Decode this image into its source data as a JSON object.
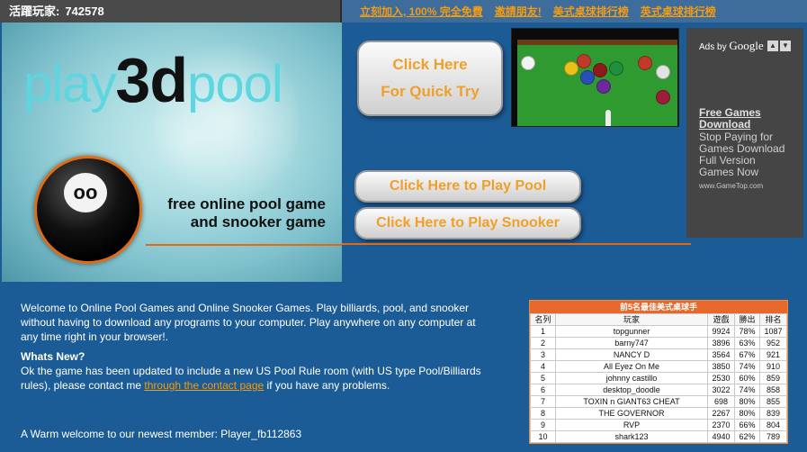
{
  "topbar": {
    "online_label": "活躍玩家:",
    "online_count": "742578",
    "links": [
      "立刻加入, 100% 完全免費",
      "邀請朋友!",
      "美式桌球排行榜",
      "英式桌球排行榜"
    ]
  },
  "hero": {
    "logo_left": "play",
    "logo_mid": "3d",
    "logo_right": "pool",
    "ball_mark": "oo",
    "tagline_1": "free online pool game",
    "tagline_2": "and snooker game"
  },
  "buttons": {
    "quick_1": "Click Here",
    "quick_2": "For Quick Try",
    "play_pool": "Click Here to Play Pool",
    "play_snooker": "Click Here to Play Snooker"
  },
  "ads": {
    "ads_by": "Ads by",
    "google": "Google",
    "title": "Free Games Download",
    "body": "Stop Paying for Games Download Full Version Games Now",
    "url": "www.GameTop.com"
  },
  "content": {
    "intro": "Welcome to Online Pool Games and Online Snooker Games. Play billiards, pool, and snooker without having to download any programs to your computer. Play anywhere on any computer at any time right in your browser!.",
    "whats_new_title": "Whats New?",
    "whats_new_before": "Ok the game has been updated to include a new US Pool Rule room (with US type Pool/Billiards rules), please contact me ",
    "whats_new_link": "through the contact page",
    "whats_new_after": " if you have any problems.",
    "welcome": "A Warm welcome to our newest member: Player_fb112863"
  },
  "ranking": {
    "title": "前5名最佳美式桌球手",
    "headers": [
      "名列",
      "玩家",
      "遊戲",
      "勝出",
      "排名"
    ],
    "rows": [
      [
        "1",
        "topgunner",
        "9924",
        "78%",
        "1087"
      ],
      [
        "2",
        "barny747",
        "3896",
        "63%",
        "952"
      ],
      [
        "3",
        "NANCY D",
        "3564",
        "67%",
        "921"
      ],
      [
        "4",
        "All Eyez On Me",
        "3850",
        "74%",
        "910"
      ],
      [
        "5",
        "johnny castillo",
        "2530",
        "60%",
        "859"
      ],
      [
        "6",
        "desktop_doodle",
        "3022",
        "74%",
        "858"
      ],
      [
        "7",
        "TOXIN n GIANT63 CHEAT",
        "698",
        "80%",
        "855"
      ],
      [
        "8",
        "THE GOVERNOR",
        "2267",
        "80%",
        "839"
      ],
      [
        "9",
        "RVP",
        "2370",
        "66%",
        "804"
      ],
      [
        "10",
        "shark123",
        "4940",
        "62%",
        "789"
      ]
    ]
  },
  "colors": {
    "background": "#1b5b96",
    "accent_orange": "#f0a02a",
    "rank_header": "#e8672a"
  }
}
